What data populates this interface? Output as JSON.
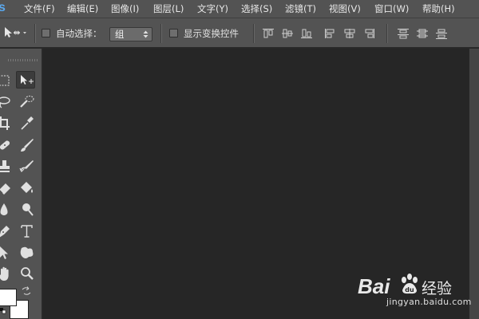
{
  "app": {
    "logo_text": "s"
  },
  "menu": {
    "items": [
      {
        "id": "file",
        "label": "文件(F)"
      },
      {
        "id": "edit",
        "label": "编辑(E)"
      },
      {
        "id": "image",
        "label": "图像(I)"
      },
      {
        "id": "layer",
        "label": "图层(L)"
      },
      {
        "id": "type",
        "label": "文字(Y)"
      },
      {
        "id": "select",
        "label": "选择(S)"
      },
      {
        "id": "filter",
        "label": "滤镜(T)"
      },
      {
        "id": "view",
        "label": "视图(V)"
      },
      {
        "id": "window",
        "label": "窗口(W)"
      },
      {
        "id": "help",
        "label": "帮助(H)"
      }
    ]
  },
  "options_bar": {
    "tool_icon": "move-tool-icon",
    "auto_select_label": "自动选择：",
    "auto_select_checked": false,
    "auto_select_target": "组",
    "show_transform_label": "显示变换控件",
    "show_transform_checked": false
  },
  "toolbox": {
    "tools": [
      "marquee-icon",
      "move-icon",
      "lasso-icon",
      "quick-select-icon",
      "crop-icon",
      "eyedropper-icon",
      "healing-brush-icon",
      "brush-icon",
      "clone-stamp-icon",
      "history-brush-icon",
      "eraser-icon",
      "paint-bucket-icon",
      "blur-icon",
      "dodge-icon",
      "pen-icon",
      "type-icon",
      "path-select-icon",
      "shape-icon",
      "hand-icon",
      "zoom-icon"
    ],
    "selected_tool": "move-icon"
  },
  "colors": {
    "chrome": "#535353",
    "canvas": "#262626",
    "accent": "#5aa9f0",
    "foreground_color": "#ffffff",
    "background_color": "#ffffff"
  },
  "watermark": {
    "brand": "Bai",
    "brand_suffix": "经验",
    "url": "jingyan.baidu.com"
  }
}
